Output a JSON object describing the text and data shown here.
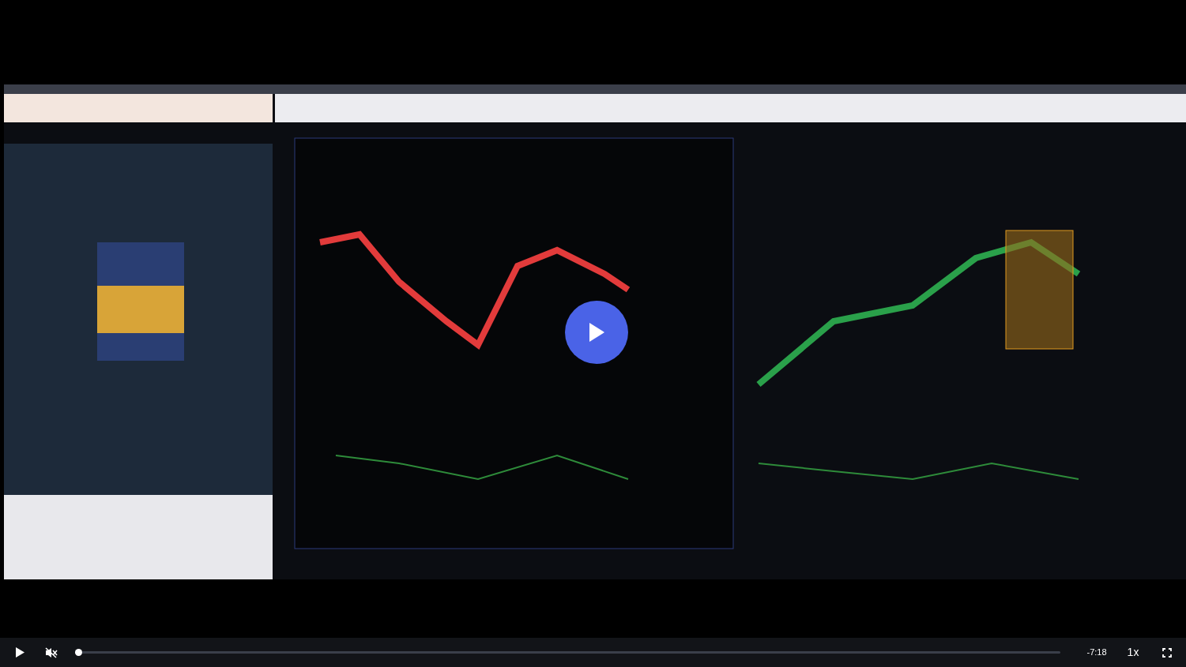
{
  "video": {
    "kind": "picture",
    "paused": true
  },
  "controls": {
    "playing": false,
    "muted": true,
    "progress": {
      "level": 0.003
    },
    "time_remaining": "-7:18",
    "speed": "1x"
  }
}
